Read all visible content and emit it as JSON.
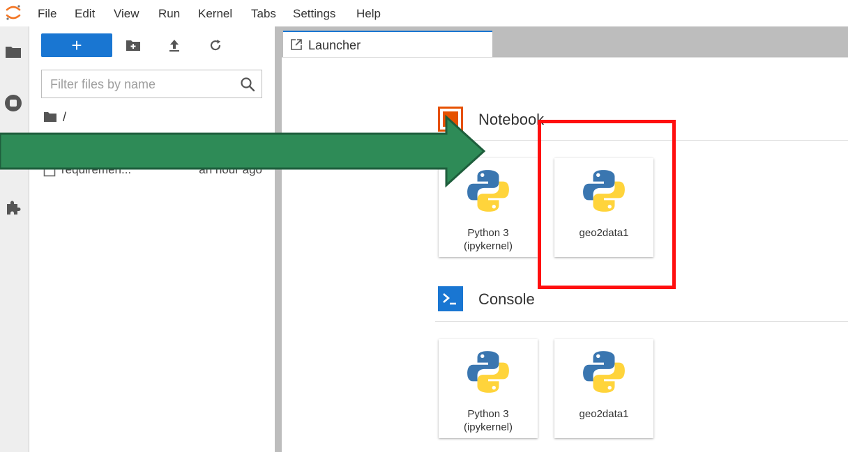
{
  "menu": {
    "items": [
      "File",
      "Edit",
      "View",
      "Run",
      "Kernel",
      "Tabs",
      "Settings",
      "Help"
    ]
  },
  "file_browser": {
    "new_button_label": "+",
    "filter_placeholder": "Filter files by name",
    "path": "/",
    "files": [
      {
        "name": "requiremen...",
        "modified": "an hour ago"
      }
    ]
  },
  "tab": {
    "label": "Launcher"
  },
  "launcher": {
    "notebook_section": {
      "title": "Notebook",
      "kernels": [
        {
          "label": "Python 3\n(ipykernel)"
        },
        {
          "label": "geo2data1"
        }
      ]
    },
    "console_section": {
      "title": "Console",
      "kernels": [
        {
          "label": "Python 3\n(ipykernel)"
        },
        {
          "label": "geo2data1"
        }
      ]
    }
  },
  "colors": {
    "accent": "#1976d2",
    "notebook_icon": "#e65100",
    "console_icon": "#1976d2",
    "highlight_box": "#ff0f0f",
    "annotation_arrow": "#2e8b57"
  },
  "icons": {
    "logo": "jupyter-logo-icon",
    "activity": [
      "folder-icon",
      "stop-circle-icon",
      "puzzle-icon"
    ],
    "toolbar": [
      "new-folder-icon",
      "upload-icon",
      "refresh-icon"
    ],
    "python": "python-logo-icon"
  }
}
